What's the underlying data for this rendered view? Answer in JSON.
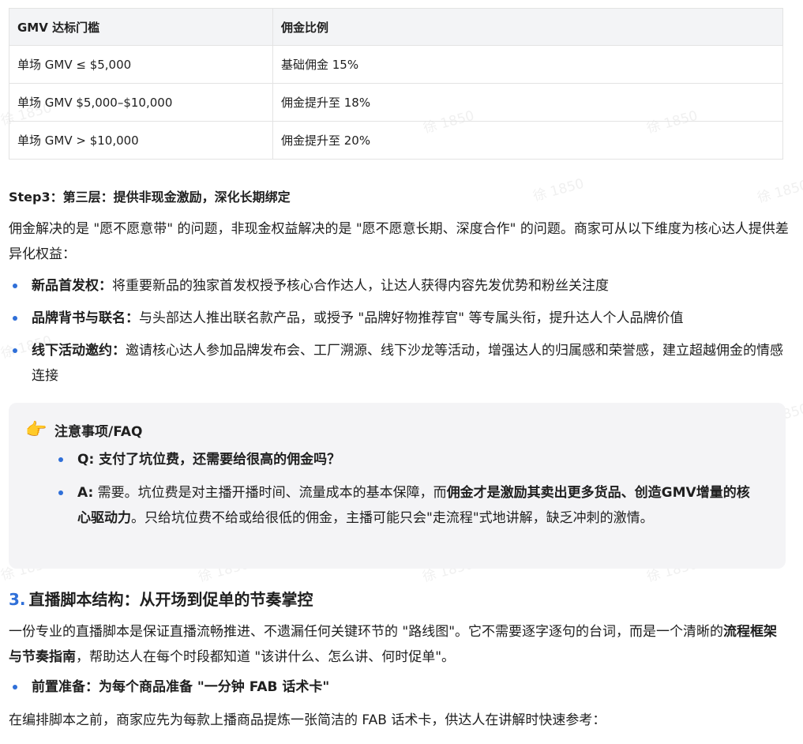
{
  "watermark": "徐 1850",
  "table": {
    "headers": [
      "GMV 达标门槛",
      "佣金比例"
    ],
    "rows": [
      [
        "单场 GMV ≤ $5,000",
        "基础佣金 15%"
      ],
      [
        "单场 GMV $5,000–$10,000",
        "佣金提升至 18%"
      ],
      [
        "单场 GMV > $10,000",
        "佣金提升至 20%"
      ]
    ]
  },
  "step3": {
    "heading": "Step3：第三层：提供非现金激励，深化长期绑定",
    "intro": "佣金解决的是 \"愿不愿意带\" 的问题，非现金权益解决的是 \"愿不愿意长期、深度合作\" 的问题。商家可从以下维度为核心达人提供差异化权益：",
    "items": [
      {
        "label": "新品首发权：",
        "text": "将重要新品的独家首发权授予核心合作达人，让达人获得内容先发优势和粉丝关注度"
      },
      {
        "label": "品牌背书与联名：",
        "text": "与头部达人推出联名款产品，或授予 \"品牌好物推荐官\" 等专属头衔，提升达人个人品牌价值"
      },
      {
        "label": "线下活动邀约：",
        "text": "邀请核心达人参加品牌发布会、工厂溯源、线下沙龙等活动，增强达人的归属感和荣誉感，建立超越佣金的情感连接"
      }
    ]
  },
  "note": {
    "icon": "pointing-hand-icon",
    "icon_glyph": "👉",
    "title": "注意事项/FAQ",
    "q": "Q: 支付了坑位费，还需要给很高的佣金吗？",
    "a_label": "A:",
    "a_text1": " 需要。坑位费是对主播开播时间、流量成本的基本保障，而",
    "a_bold": "佣金才是激励其卖出更多货品、创造GMV增量的核心驱动力",
    "a_text2": "。只给坑位费不给或给很低的佣金，主播可能只会\"走流程\"式地讲解，缺乏冲刺的激情。"
  },
  "section3": {
    "number": "3.",
    "title": "直播脚本结构：从开场到促单的节奏掌控",
    "p_text1": "一份专业的直播脚本是保证直播流畅推进、不遗漏任何关键环节的 \"路线图\"。它不需要逐字逐句的台词，而是一个清晰的",
    "p_bold": "流程框架与节奏指南",
    "p_text2": "，帮助达人在每个时段都知道 \"该讲什么、怎么讲、何时促单\"。",
    "bullet": "前置准备：为每个商品准备 \"一分钟 FAB 话术卡\"",
    "last": "在编排脚本之前，商家应先为每款上播商品提炼一张简洁的 FAB 话术卡，供达人在讲解时快速参考："
  },
  "colors": {
    "accent": "#2f6fd8",
    "header_bg": "#f3f4f6",
    "note_bg": "#f4f4f6",
    "border": "#e3e3e3"
  }
}
